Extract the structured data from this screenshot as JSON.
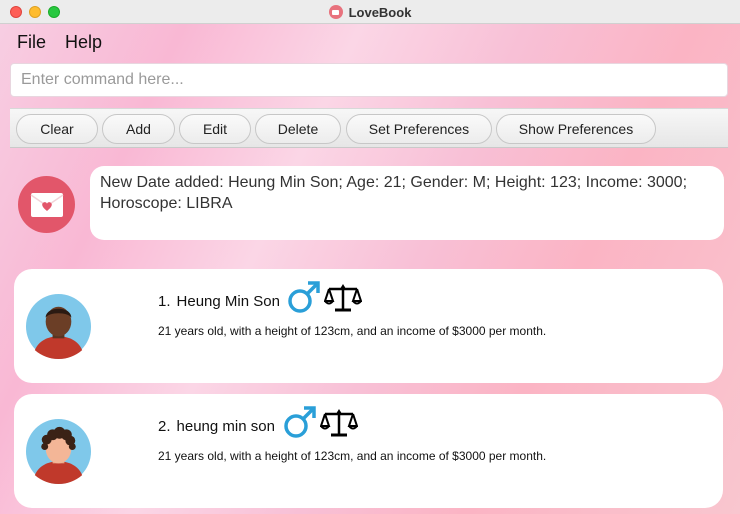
{
  "window": {
    "title": "LoveBook"
  },
  "menu": {
    "file": "File",
    "help": "Help"
  },
  "command": {
    "placeholder": "Enter command here...",
    "value": ""
  },
  "toolbar": {
    "clear": "Clear",
    "add": "Add",
    "edit": "Edit",
    "delete": "Delete",
    "set_preferences": "Set Preferences",
    "show_preferences": "Show Preferences"
  },
  "result": {
    "message": "New Date added: Heung Min Son; Age: 21; Gender: M; Height: 123; Income: 3000; Horoscope: LIBRA"
  },
  "colors": {
    "accent": "#e2566a",
    "gender_male": "#2a9fd8",
    "avatar_bg": "#7fc8ea",
    "shirt": "#c0392b"
  },
  "dates": [
    {
      "index": "1.",
      "name": "Heung Min Son",
      "gender_icon": "male-symbol-icon",
      "horoscope_icon": "libra-icon",
      "description": "21 years old, with a height of 123cm, and an income of $3000 per month."
    },
    {
      "index": "2.",
      "name": "heung min son",
      "gender_icon": "male-symbol-icon",
      "horoscope_icon": "libra-icon",
      "description": "21 years old, with a height of 123cm, and an income of $3000 per month."
    }
  ]
}
